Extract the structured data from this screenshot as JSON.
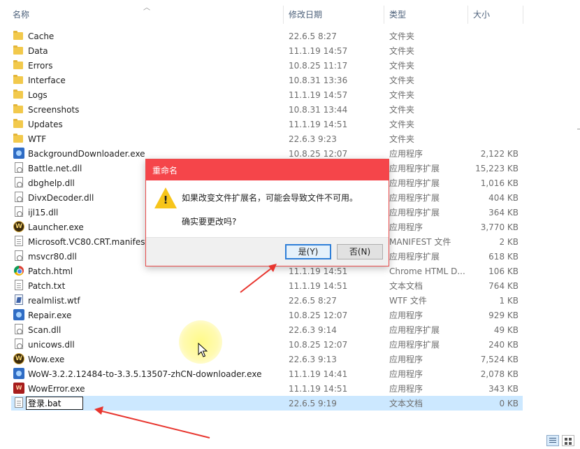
{
  "columns": {
    "name": "名称",
    "date": "修改日期",
    "type": "类型",
    "size": "大小"
  },
  "files": [
    {
      "name": "Cache",
      "date": "22.6.5 8:27",
      "type": "文件夹",
      "size": "",
      "icon": "folder-icon"
    },
    {
      "name": "Data",
      "date": "11.1.19 14:57",
      "type": "文件夹",
      "size": "",
      "icon": "folder-icon"
    },
    {
      "name": "Errors",
      "date": "10.8.25 11:17",
      "type": "文件夹",
      "size": "",
      "icon": "folder-icon"
    },
    {
      "name": "Interface",
      "date": "10.8.31 13:36",
      "type": "文件夹",
      "size": "",
      "icon": "folder-icon"
    },
    {
      "name": "Logs",
      "date": "11.1.19 14:57",
      "type": "文件夹",
      "size": "",
      "icon": "folder-icon"
    },
    {
      "name": "Screenshots",
      "date": "10.8.31 13:44",
      "type": "文件夹",
      "size": "",
      "icon": "folder-icon"
    },
    {
      "name": "Updates",
      "date": "11.1.19 14:51",
      "type": "文件夹",
      "size": "",
      "icon": "folder-icon"
    },
    {
      "name": "WTF",
      "date": "22.6.3 9:23",
      "type": "文件夹",
      "size": "",
      "icon": "folder-icon"
    },
    {
      "name": "BackgroundDownloader.exe",
      "date": "10.8.25 12:07",
      "type": "应用程序",
      "size": "2,122 KB",
      "icon": "blizzard-exe-icon"
    },
    {
      "name": "Battle.net.dll",
      "date": "",
      "type": "应用程序扩展",
      "size": "15,223 KB",
      "icon": "dll-icon"
    },
    {
      "name": "dbghelp.dll",
      "date": "",
      "type": "应用程序扩展",
      "size": "1,016 KB",
      "icon": "dll-icon"
    },
    {
      "name": "DivxDecoder.dll",
      "date": "",
      "type": "应用程序扩展",
      "size": "404 KB",
      "icon": "dll-icon"
    },
    {
      "name": "ijl15.dll",
      "date": "",
      "type": "应用程序扩展",
      "size": "364 KB",
      "icon": "dll-icon"
    },
    {
      "name": "Launcher.exe",
      "date": "",
      "type": "应用程序",
      "size": "3,770 KB",
      "icon": "wow-icon"
    },
    {
      "name": "Microsoft.VC80.CRT.manifest",
      "date": "",
      "type": "MANIFEST 文件",
      "size": "2 KB",
      "icon": "document-icon"
    },
    {
      "name": "msvcr80.dll",
      "date": "",
      "type": "应用程序扩展",
      "size": "618 KB",
      "icon": "dll-icon"
    },
    {
      "name": "Patch.html",
      "date": "11.1.19 14:51",
      "type": "Chrome HTML D...",
      "size": "106 KB",
      "icon": "chrome-icon"
    },
    {
      "name": "Patch.txt",
      "date": "11.1.19 14:51",
      "type": "文本文档",
      "size": "764 KB",
      "icon": "document-icon"
    },
    {
      "name": "realmlist.wtf",
      "date": "22.6.5 8:27",
      "type": "WTF 文件",
      "size": "1 KB",
      "icon": "wtf-file-icon"
    },
    {
      "name": "Repair.exe",
      "date": "10.8.25 12:07",
      "type": "应用程序",
      "size": "929 KB",
      "icon": "blizzard-exe-icon"
    },
    {
      "name": "Scan.dll",
      "date": "22.6.3 9:14",
      "type": "应用程序扩展",
      "size": "49 KB",
      "icon": "dll-icon"
    },
    {
      "name": "unicows.dll",
      "date": "10.8.25 12:07",
      "type": "应用程序扩展",
      "size": "240 KB",
      "icon": "dll-icon"
    },
    {
      "name": "Wow.exe",
      "date": "22.6.3 9:13",
      "type": "应用程序",
      "size": "7,524 KB",
      "icon": "wow-icon"
    },
    {
      "name": "WoW-3.2.2.12484-to-3.3.5.13507-zhCN-downloader.exe",
      "date": "11.1.19 14:41",
      "type": "应用程序",
      "size": "2,078 KB",
      "icon": "blizzard-exe-icon"
    },
    {
      "name": "WowError.exe",
      "date": "11.1.19 14:51",
      "type": "应用程序",
      "size": "343 KB",
      "icon": "wow-error-icon"
    },
    {
      "name": "登录.bat",
      "date": "22.6.5 9:19",
      "type": "文本文档",
      "size": "0 KB",
      "icon": "document-icon",
      "selected": true,
      "renaming": true
    }
  ],
  "dialog": {
    "title": "重命名",
    "message1": "如果改变文件扩展名，可能会导致文件不可用。",
    "message2": "确实要更改吗?",
    "yes_label": "是(Y)",
    "no_label": "否(N)"
  },
  "colors": {
    "dialog_title_bg": "#f5454a",
    "selection_bg": "#cce8ff",
    "annotation_arrow": "#e8352e",
    "folder": "#f2c94c"
  }
}
